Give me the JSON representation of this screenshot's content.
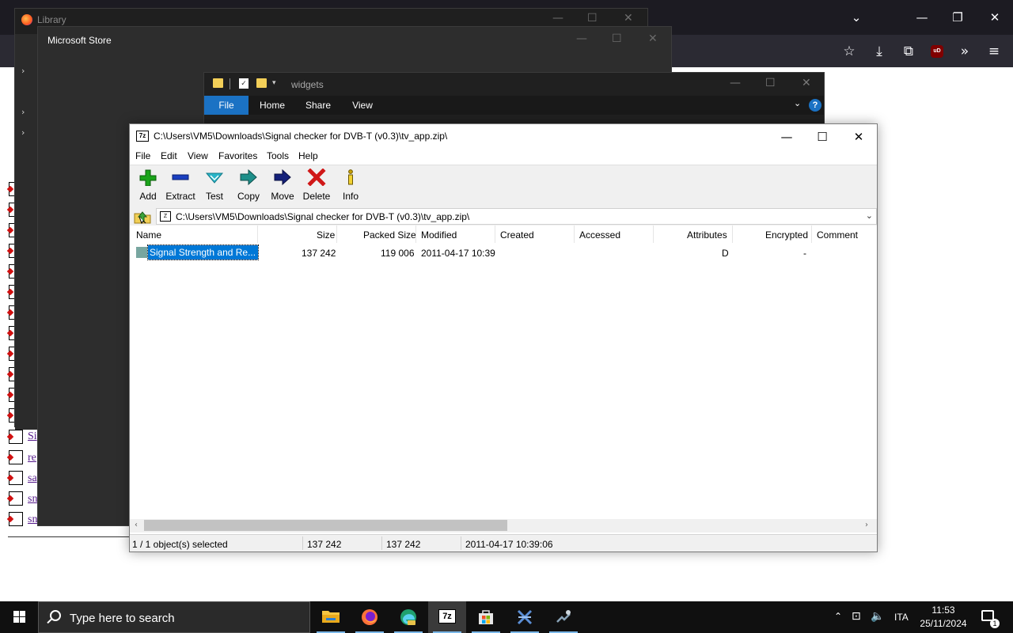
{
  "browser": {
    "icons": [
      "list-all-tabs-icon",
      "minimize-icon",
      "restore-icon",
      "close-icon",
      "bookmark-star-icon",
      "downloads-icon",
      "extensions-icon",
      "ublock-icon",
      "overflow-chevrons-icon",
      "hamburger-menu-icon"
    ],
    "ublock_label": "uD",
    "controls": {
      "minimize": "—",
      "restore": "❐",
      "close": "✕",
      "tabs": "⌄"
    },
    "tools": {
      "star": "☆",
      "download": "⤓",
      "extensions": "⧉",
      "overflow": "»",
      "menu": "≡"
    },
    "content_links": [
      "Si",
      "re",
      "sa",
      "sn",
      "sn"
    ]
  },
  "library_window": {
    "title": "Library",
    "controls": {
      "minimize": "—",
      "maximize": "☐",
      "close": "✕"
    }
  },
  "store_window": {
    "title": "Microsoft Store",
    "controls": {
      "minimize": "—",
      "maximize": "☐",
      "close": "✕"
    }
  },
  "explorer_window": {
    "title": "widgets",
    "qa_check": "✓",
    "qa_dropdown": "▾",
    "controls": {
      "minimize": "—",
      "maximize": "☐",
      "close": "✕"
    },
    "ribbon_tabs": [
      "File",
      "Home",
      "Share",
      "View"
    ],
    "expand_glyph": "⌄",
    "help_glyph": "?"
  },
  "sevenzip": {
    "title": "C:\\Users\\VM5\\Downloads\\Signal checker for DVB-T (v0.3)\\tv_app.zip\\",
    "app_icon_label": "7z",
    "controls": {
      "minimize": "—",
      "maximize": "☐",
      "close": "✕"
    },
    "menu": [
      "File",
      "Edit",
      "View",
      "Favorites",
      "Tools",
      "Help"
    ],
    "toolbar": [
      {
        "label": "Add",
        "icon": "add-icon",
        "color": "#1aa31a"
      },
      {
        "label": "Extract",
        "icon": "extract-icon",
        "color": "#1a3fc0"
      },
      {
        "label": "Test",
        "icon": "test-icon",
        "color": "#2ab5c8"
      },
      {
        "label": "Copy",
        "icon": "copy-icon",
        "color": "#1e8f8a"
      },
      {
        "label": "Move",
        "icon": "move-icon",
        "color": "#14207a"
      },
      {
        "label": "Delete",
        "icon": "delete-icon",
        "color": "#d01818"
      },
      {
        "label": "Info",
        "icon": "info-icon",
        "color": "#c8a000"
      }
    ],
    "address": {
      "path": "C:\\Users\\VM5\\Downloads\\Signal checker for DVB-T (v0.3)\\tv_app.zip\\",
      "dropdown": "⌄"
    },
    "columns": [
      "Name",
      "Size",
      "Packed Size",
      "Modified",
      "Created",
      "Accessed",
      "Attributes",
      "Encrypted",
      "Comment"
    ],
    "rows": [
      {
        "name": "Signal Strength and Re...",
        "size": "137 242",
        "packed_size": "119 006",
        "modified": "2011-04-17 10:39",
        "created": "",
        "accessed": "",
        "attributes": "D",
        "encrypted": "-",
        "comment": "",
        "selected": true
      }
    ],
    "scroll_arrows": {
      "left": "‹",
      "right": "›"
    },
    "status": {
      "selection": "1 / 1 object(s) selected",
      "size": "137 242",
      "packed": "137 242",
      "modified": "2011-04-17 10:39:06"
    }
  },
  "taskbar": {
    "search_placeholder": "Type here to search",
    "apps": [
      "file-explorer-icon",
      "firefox-icon",
      "edge-dev-icon",
      "7zip-icon",
      "microsoft-store-icon",
      "xml-tool-icon",
      "network-tool-icon"
    ],
    "app_7z_label": "7z",
    "tray": {
      "chevron": "⌃",
      "network": "⊡",
      "volume": "🔈",
      "language": "ITA",
      "time": "11:53",
      "date": "25/11/2024",
      "notifications_count": "1"
    }
  }
}
